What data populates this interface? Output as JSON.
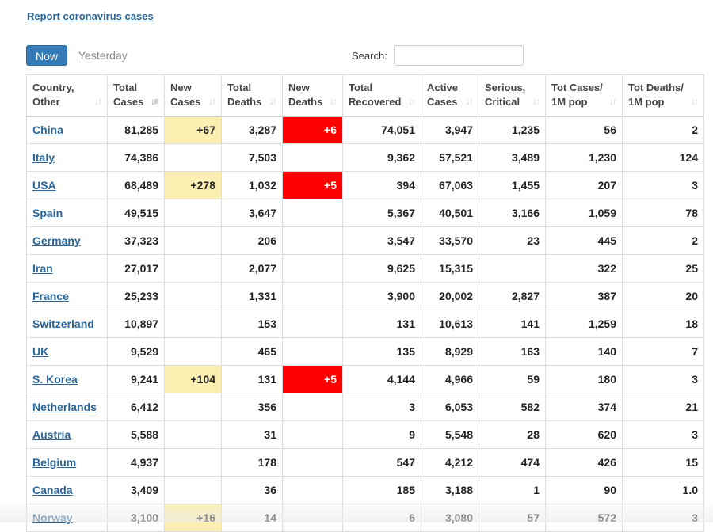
{
  "header": {
    "report_link": "Report coronavirus cases"
  },
  "tabs": [
    {
      "label": "Now",
      "active": true
    },
    {
      "label": "Yesterday",
      "active": false
    }
  ],
  "search": {
    "label": "Search:",
    "value": "",
    "placeholder": ""
  },
  "colors": {
    "link": "#2a6496",
    "tab_active": "#337ab7",
    "new_cases_highlight": "#fcefb2",
    "new_deaths_highlight": "#ff0000"
  },
  "table": {
    "columns": [
      {
        "line1": "Country,",
        "line2": "Other",
        "sort_icon": "sort-both-icon"
      },
      {
        "line1": "Total",
        "line2": "Cases",
        "sort_icon": "sort-desc-icon"
      },
      {
        "line1": "New",
        "line2": "Cases",
        "sort_icon": "sort-both-icon"
      },
      {
        "line1": "Total",
        "line2": "Deaths",
        "sort_icon": "sort-both-icon"
      },
      {
        "line1": "New",
        "line2": "Deaths",
        "sort_icon": "sort-both-icon"
      },
      {
        "line1": "Total",
        "line2": "Recovered",
        "sort_icon": "sort-both-icon"
      },
      {
        "line1": "Active",
        "line2": "Cases",
        "sort_icon": "sort-both-icon"
      },
      {
        "line1": "Serious,",
        "line2": "Critical",
        "sort_icon": "sort-both-icon"
      },
      {
        "line1": "Tot Cases/",
        "line2": "1M pop",
        "sort_icon": "sort-both-icon"
      },
      {
        "line1": "Tot Deaths/",
        "line2": "1M pop",
        "sort_icon": "sort-both-icon"
      }
    ],
    "rows": [
      {
        "country": "China",
        "total_cases": "81,285",
        "new_cases": "+67",
        "total_deaths": "3,287",
        "new_deaths": "+6",
        "total_recovered": "74,051",
        "active_cases": "3,947",
        "serious_critical": "1,235",
        "cases_per_1m": "56",
        "deaths_per_1m": "2"
      },
      {
        "country": "Italy",
        "total_cases": "74,386",
        "new_cases": "",
        "total_deaths": "7,503",
        "new_deaths": "",
        "total_recovered": "9,362",
        "active_cases": "57,521",
        "serious_critical": "3,489",
        "cases_per_1m": "1,230",
        "deaths_per_1m": "124"
      },
      {
        "country": "USA",
        "total_cases": "68,489",
        "new_cases": "+278",
        "total_deaths": "1,032",
        "new_deaths": "+5",
        "total_recovered": "394",
        "active_cases": "67,063",
        "serious_critical": "1,455",
        "cases_per_1m": "207",
        "deaths_per_1m": "3"
      },
      {
        "country": "Spain",
        "total_cases": "49,515",
        "new_cases": "",
        "total_deaths": "3,647",
        "new_deaths": "",
        "total_recovered": "5,367",
        "active_cases": "40,501",
        "serious_critical": "3,166",
        "cases_per_1m": "1,059",
        "deaths_per_1m": "78"
      },
      {
        "country": "Germany",
        "total_cases": "37,323",
        "new_cases": "",
        "total_deaths": "206",
        "new_deaths": "",
        "total_recovered": "3,547",
        "active_cases": "33,570",
        "serious_critical": "23",
        "cases_per_1m": "445",
        "deaths_per_1m": "2"
      },
      {
        "country": "Iran",
        "total_cases": "27,017",
        "new_cases": "",
        "total_deaths": "2,077",
        "new_deaths": "",
        "total_recovered": "9,625",
        "active_cases": "15,315",
        "serious_critical": "",
        "cases_per_1m": "322",
        "deaths_per_1m": "25"
      },
      {
        "country": "France",
        "total_cases": "25,233",
        "new_cases": "",
        "total_deaths": "1,331",
        "new_deaths": "",
        "total_recovered": "3,900",
        "active_cases": "20,002",
        "serious_critical": "2,827",
        "cases_per_1m": "387",
        "deaths_per_1m": "20"
      },
      {
        "country": "Switzerland",
        "total_cases": "10,897",
        "new_cases": "",
        "total_deaths": "153",
        "new_deaths": "",
        "total_recovered": "131",
        "active_cases": "10,613",
        "serious_critical": "141",
        "cases_per_1m": "1,259",
        "deaths_per_1m": "18"
      },
      {
        "country": "UK",
        "total_cases": "9,529",
        "new_cases": "",
        "total_deaths": "465",
        "new_deaths": "",
        "total_recovered": "135",
        "active_cases": "8,929",
        "serious_critical": "163",
        "cases_per_1m": "140",
        "deaths_per_1m": "7"
      },
      {
        "country": "S. Korea",
        "total_cases": "9,241",
        "new_cases": "+104",
        "total_deaths": "131",
        "new_deaths": "+5",
        "total_recovered": "4,144",
        "active_cases": "4,966",
        "serious_critical": "59",
        "cases_per_1m": "180",
        "deaths_per_1m": "3"
      },
      {
        "country": "Netherlands",
        "total_cases": "6,412",
        "new_cases": "",
        "total_deaths": "356",
        "new_deaths": "",
        "total_recovered": "3",
        "active_cases": "6,053",
        "serious_critical": "582",
        "cases_per_1m": "374",
        "deaths_per_1m": "21"
      },
      {
        "country": "Austria",
        "total_cases": "5,588",
        "new_cases": "",
        "total_deaths": "31",
        "new_deaths": "",
        "total_recovered": "9",
        "active_cases": "5,548",
        "serious_critical": "28",
        "cases_per_1m": "620",
        "deaths_per_1m": "3"
      },
      {
        "country": "Belgium",
        "total_cases": "4,937",
        "new_cases": "",
        "total_deaths": "178",
        "new_deaths": "",
        "total_recovered": "547",
        "active_cases": "4,212",
        "serious_critical": "474",
        "cases_per_1m": "426",
        "deaths_per_1m": "15"
      },
      {
        "country": "Canada",
        "total_cases": "3,409",
        "new_cases": "",
        "total_deaths": "36",
        "new_deaths": "",
        "total_recovered": "185",
        "active_cases": "3,188",
        "serious_critical": "1",
        "cases_per_1m": "90",
        "deaths_per_1m": "1.0"
      },
      {
        "country": "Norway",
        "total_cases": "3,100",
        "new_cases": "+16",
        "total_deaths": "14",
        "new_deaths": "",
        "total_recovered": "6",
        "active_cases": "3,080",
        "serious_critical": "57",
        "cases_per_1m": "572",
        "deaths_per_1m": "3"
      }
    ]
  }
}
